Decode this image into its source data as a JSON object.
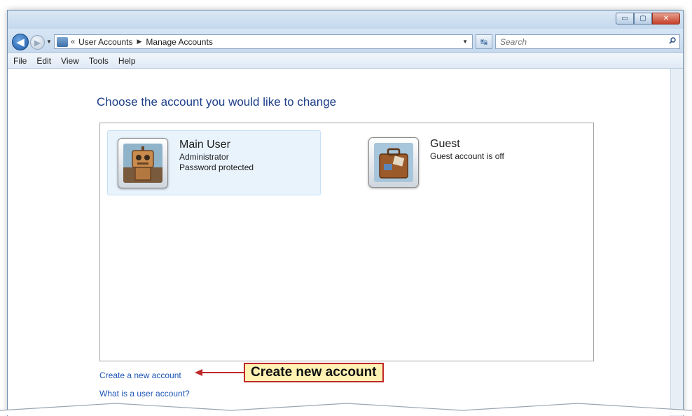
{
  "window": {
    "controls": {
      "minimize": "▭",
      "maximize": "▢",
      "close": "✕"
    }
  },
  "nav": {
    "back_icon": "back-arrow-icon",
    "forward_icon": "forward-arrow-icon",
    "breadcrumb_chevron": "«",
    "breadcrumbs": [
      "User Accounts",
      "Manage Accounts"
    ],
    "separator": "▶",
    "search_placeholder": "Search"
  },
  "menu": [
    "File",
    "Edit",
    "View",
    "Tools",
    "Help"
  ],
  "main": {
    "heading": "Choose the account you would like to change",
    "accounts": [
      {
        "name": "Main User",
        "details": [
          "Administrator",
          "Password protected"
        ],
        "selected": true,
        "icon": "robot-avatar-icon"
      },
      {
        "name": "Guest",
        "details": [
          "Guest account is off"
        ],
        "selected": false,
        "icon": "suitcase-avatar-icon"
      }
    ],
    "links": [
      "Create a new account",
      "What is a user account?"
    ]
  },
  "callout": {
    "text": "Create new account"
  },
  "colors": {
    "heading": "#1d3f8a",
    "link": "#1d55b6",
    "callout_bg": "#fff2b3",
    "callout_border": "#c0282a"
  }
}
